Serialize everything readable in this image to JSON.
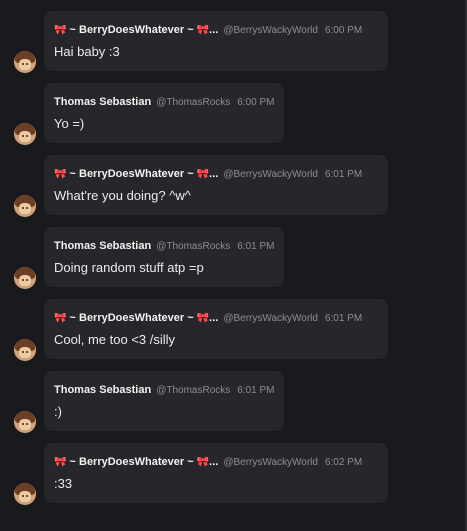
{
  "messages": [
    {
      "user": "berry",
      "ribbon_left": "🎀",
      "name": "~ BerryDoesWhatever ~",
      "ribbon_right": "🎀",
      "ellipsis": "...",
      "handle": "@BerrysWackyWorld",
      "time": "6:00 PM",
      "text": "Hai baby :3"
    },
    {
      "user": "thomas",
      "name": "Thomas Sebastian",
      "handle": "@ThomasRocks",
      "time": "6:00 PM",
      "text": "Yo =)"
    },
    {
      "user": "berry",
      "ribbon_left": "🎀",
      "name": "~ BerryDoesWhatever ~",
      "ribbon_right": "🎀",
      "ellipsis": "...",
      "handle": "@BerrysWackyWorld",
      "time": "6:01 PM",
      "text": "What're you doing? ^w^"
    },
    {
      "user": "thomas",
      "name": "Thomas Sebastian",
      "handle": "@ThomasRocks",
      "time": "6:01 PM",
      "text": "Doing random stuff atp =p"
    },
    {
      "user": "berry",
      "ribbon_left": "🎀",
      "name": "~ BerryDoesWhatever ~",
      "ribbon_right": "🎀",
      "ellipsis": "...",
      "handle": "@BerrysWackyWorld",
      "time": "6:01 PM",
      "text": "Cool, me too <3 /silly"
    },
    {
      "user": "thomas",
      "name": "Thomas Sebastian",
      "handle": "@ThomasRocks",
      "time": "6:01 PM",
      "text": ":)"
    },
    {
      "user": "berry",
      "ribbon_left": "🎀",
      "name": "~ BerryDoesWhatever ~",
      "ribbon_right": "🎀",
      "ellipsis": "...",
      "handle": "@BerrysWackyWorld",
      "time": "6:02 PM",
      "text": ":33"
    }
  ],
  "colors": {
    "background": "#1a1a1e",
    "bubble": "#26262b",
    "ribbon": "#e0457b",
    "muted": "#8d8d93"
  }
}
